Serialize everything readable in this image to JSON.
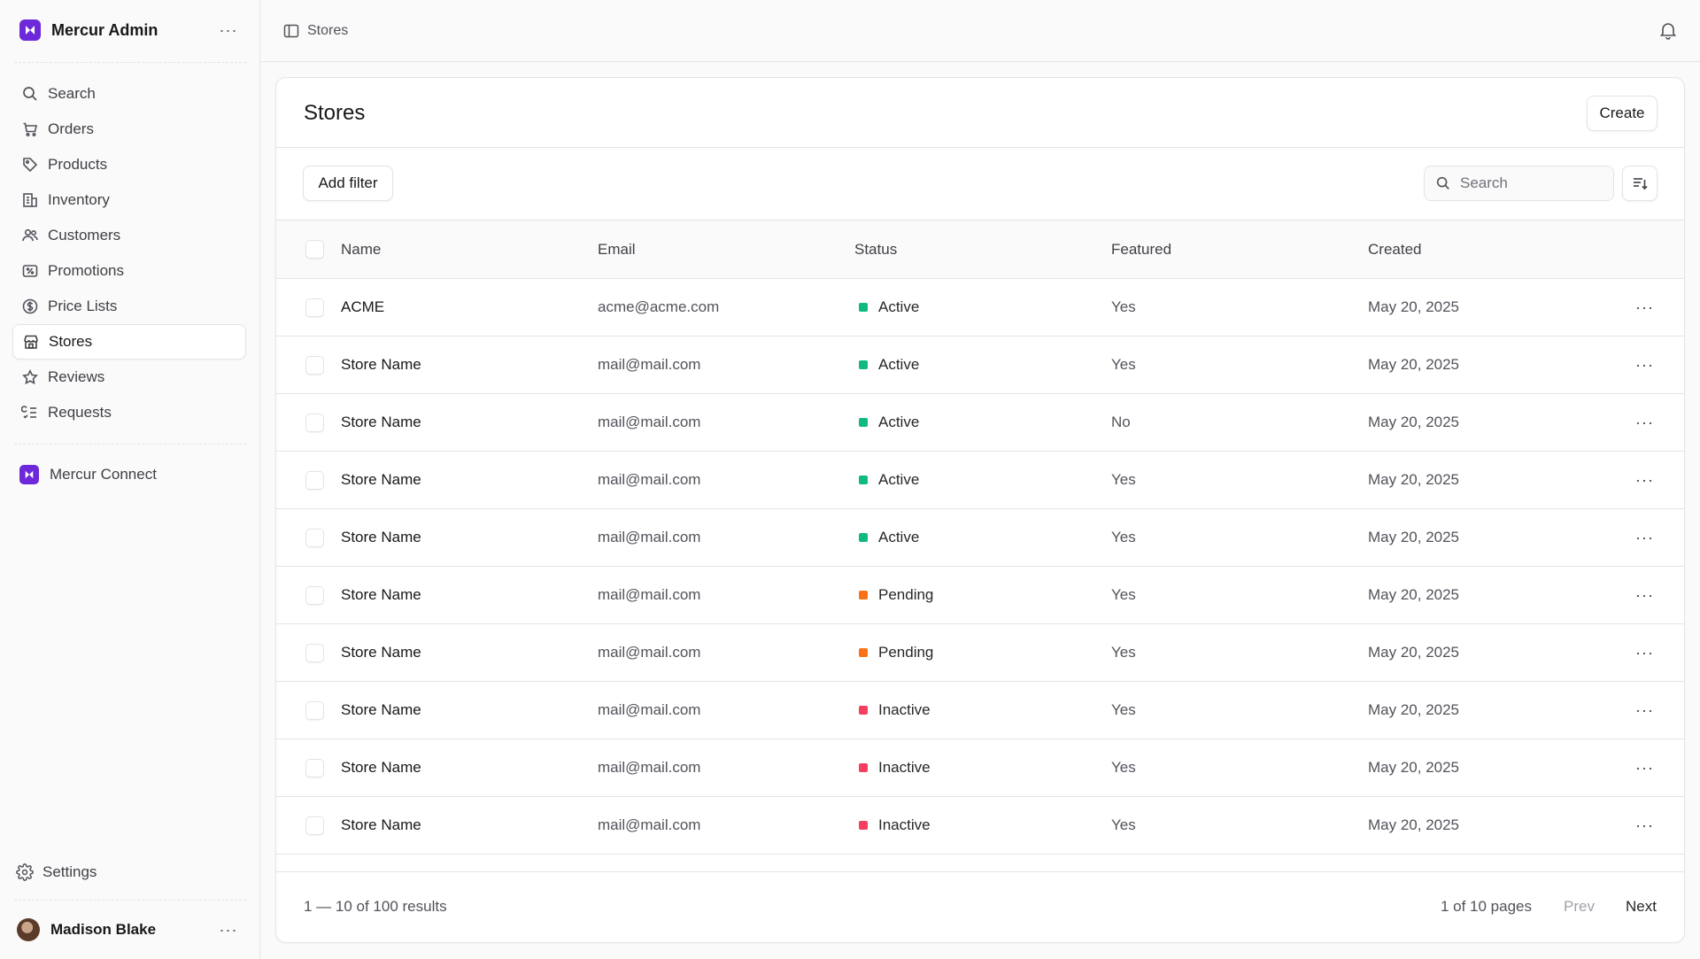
{
  "app": {
    "name": "Mercur Admin"
  },
  "sidebar": {
    "items": [
      {
        "label": "Search",
        "icon": "search-icon"
      },
      {
        "label": "Orders",
        "icon": "cart-icon"
      },
      {
        "label": "Products",
        "icon": "tag-icon"
      },
      {
        "label": "Inventory",
        "icon": "building-icon"
      },
      {
        "label": "Customers",
        "icon": "users-icon"
      },
      {
        "label": "Promotions",
        "icon": "receipt-percent-icon"
      },
      {
        "label": "Price Lists",
        "icon": "currency-dollar-icon"
      },
      {
        "label": "Stores",
        "icon": "store-icon",
        "active": true
      },
      {
        "label": "Reviews",
        "icon": "star-icon"
      },
      {
        "label": "Requests",
        "icon": "list-check-icon"
      }
    ],
    "extension": {
      "label": "Mercur Connect"
    },
    "settings": {
      "label": "Settings"
    },
    "user": {
      "name": "Madison Blake"
    }
  },
  "topbar": {
    "breadcrumb": "Stores"
  },
  "page": {
    "title": "Stores",
    "create_label": "Create",
    "add_filter_label": "Add filter",
    "search_placeholder": "Search"
  },
  "table": {
    "columns": [
      "Name",
      "Email",
      "Status",
      "Featured",
      "Created"
    ],
    "rows": [
      {
        "name": "ACME",
        "email": "acme@acme.com",
        "status": "Active",
        "featured": "Yes",
        "created": "May 20, 2025"
      },
      {
        "name": "Store Name",
        "email": "mail@mail.com",
        "status": "Active",
        "featured": "Yes",
        "created": "May 20, 2025"
      },
      {
        "name": "Store Name",
        "email": "mail@mail.com",
        "status": "Active",
        "featured": "No",
        "created": "May 20, 2025"
      },
      {
        "name": "Store Name",
        "email": "mail@mail.com",
        "status": "Active",
        "featured": "Yes",
        "created": "May 20, 2025"
      },
      {
        "name": "Store Name",
        "email": "mail@mail.com",
        "status": "Active",
        "featured": "Yes",
        "created": "May 20, 2025"
      },
      {
        "name": "Store Name",
        "email": "mail@mail.com",
        "status": "Pending",
        "featured": "Yes",
        "created": "May 20, 2025"
      },
      {
        "name": "Store Name",
        "email": "mail@mail.com",
        "status": "Pending",
        "featured": "Yes",
        "created": "May 20, 2025"
      },
      {
        "name": "Store Name",
        "email": "mail@mail.com",
        "status": "Inactive",
        "featured": "Yes",
        "created": "May 20, 2025"
      },
      {
        "name": "Store Name",
        "email": "mail@mail.com",
        "status": "Inactive",
        "featured": "Yes",
        "created": "May 20, 2025"
      },
      {
        "name": "Store Name",
        "email": "mail@mail.com",
        "status": "Inactive",
        "featured": "Yes",
        "created": "May 20, 2025"
      }
    ]
  },
  "status_colors": {
    "Active": "#10b981",
    "Pending": "#f97316",
    "Inactive": "#f43f5e"
  },
  "pagination": {
    "results": "1 — 10 of 100 results",
    "pages": "1 of 10 pages",
    "prev_label": "Prev",
    "next_label": "Next"
  },
  "colors": {
    "brand": "#6d28d9"
  }
}
